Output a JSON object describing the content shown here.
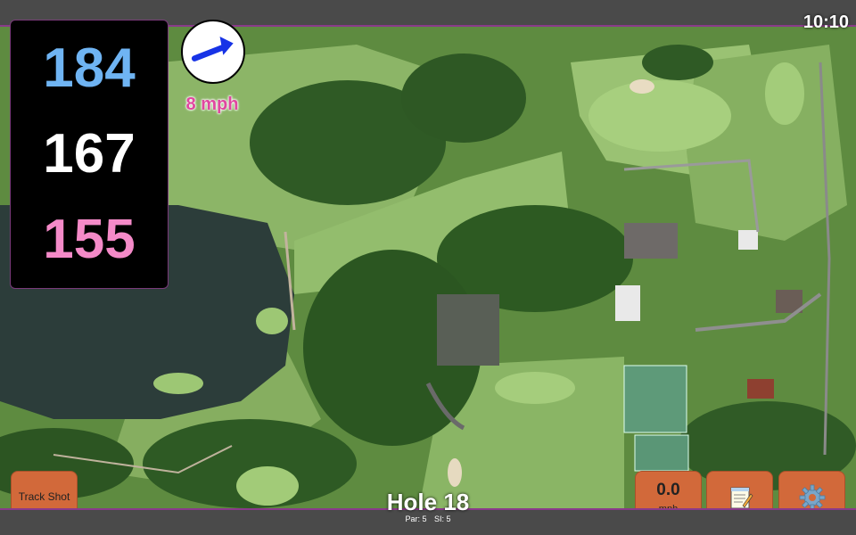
{
  "clock": "10:10",
  "distances": {
    "back": "184",
    "middle": "167",
    "front": "155"
  },
  "wind": {
    "speed": "8 mph",
    "direction_icon": "arrow-northeast-icon"
  },
  "buttons": {
    "track_shot": "Track Shot",
    "speed_value": "0.0",
    "speed_unit": "mph",
    "notes_icon": "notepad-icon",
    "settings_icon": "gear-icon"
  },
  "hole": {
    "title": "Hole 18",
    "par": "Par: 5",
    "si": "SI: 5"
  },
  "colors": {
    "back": "#6fb4f3",
    "middle": "#ffffff",
    "front": "#f48ac8",
    "button": "#d2693a",
    "accent": "#8a3a8a"
  }
}
